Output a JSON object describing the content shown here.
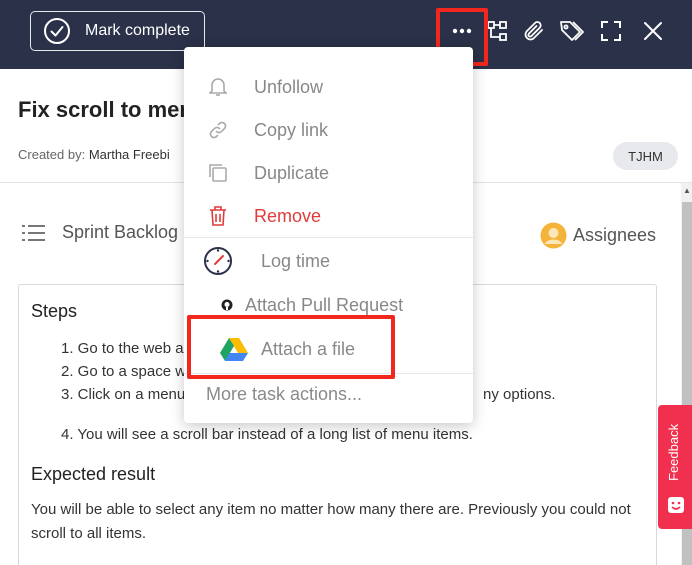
{
  "toolbar": {
    "mark_complete_label": "Mark complete",
    "icons": [
      "more-icon",
      "subtasks-icon",
      "paperclip-icon",
      "tag-icon",
      "expand-icon",
      "close-icon"
    ]
  },
  "task": {
    "title": "Fix scroll to menu",
    "created_by_label": "Created by:",
    "created_by_name": "Martha Freebi",
    "badge": "TJHM",
    "list_name": "Sprint Backlog",
    "assignees_label": "Assignees"
  },
  "description": {
    "steps_heading": "Steps",
    "steps": [
      "1. Go to the web a",
      "2. Go to a space w",
      "3. Click on a menu",
      "4. You will see a scroll bar instead of a long list of menu items."
    ],
    "steps_tail": "ny options.",
    "expected_heading": "Expected result",
    "expected_text": "You will be able to select any item no matter how many there are. Previously you could not scroll to all items."
  },
  "menu": {
    "items": [
      {
        "label": "Unfollow",
        "icon": "bell-icon"
      },
      {
        "label": "Copy link",
        "icon": "link-icon"
      },
      {
        "label": "Duplicate",
        "icon": "duplicate-icon"
      },
      {
        "label": "Remove",
        "icon": "trash-icon"
      },
      {
        "label": "Log time",
        "icon": "stopwatch-icon"
      },
      {
        "label": "Attach Pull Request",
        "icon": "github-icon"
      },
      {
        "label": "Attach a file",
        "icon": "google-drive-icon"
      }
    ],
    "more_label": "More task actions..."
  },
  "feedback": {
    "label": "Feedback"
  },
  "colors": {
    "topbar": "#2a3148",
    "danger": "#e03b3b",
    "highlight": "#f2281f",
    "feedback": "#f0304e"
  }
}
